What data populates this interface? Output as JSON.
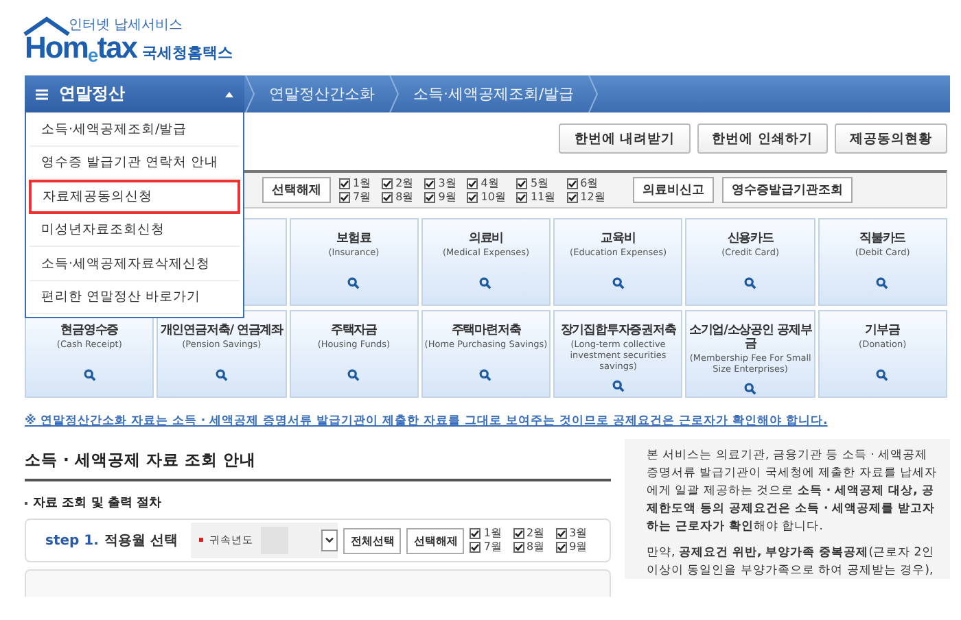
{
  "logo": {
    "tagline": "인터넷 납세서비스",
    "wordmark": "Hom$_{e}$tax",
    "name": "국세청홈택스"
  },
  "nav": {
    "menu_title": "연말정산",
    "menu_expanded": true,
    "breadcrumbs": [
      "연말정산간소화",
      "소득·세액공제조회/발급"
    ]
  },
  "menu_items": [
    {
      "label": "소득·세액공제조회/발급",
      "selected": false
    },
    {
      "label": "영수증 발급기관 연락처 안내",
      "selected": false
    },
    {
      "label": "자료제공동의신청",
      "selected": true
    },
    {
      "label": "미성년자료조회신청",
      "selected": false
    },
    {
      "label": "소득·세액공제자료삭제신청",
      "selected": false
    },
    {
      "label": "편리한 연말정산 바로가기",
      "selected": false
    }
  ],
  "actions": [
    "한번에 내려받기",
    "한번에 인쇄하기",
    "제공동의현황"
  ],
  "filter": {
    "clear_button": "선택해제",
    "months": [
      {
        "label": "1월",
        "checked": true
      },
      {
        "label": "2월",
        "checked": true
      },
      {
        "label": "3월",
        "checked": true
      },
      {
        "label": "4월",
        "checked": true
      },
      {
        "label": "5월",
        "checked": true
      },
      {
        "label": "6월",
        "checked": true
      },
      {
        "label": "7월",
        "checked": true
      },
      {
        "label": "8월",
        "checked": true
      },
      {
        "label": "9월",
        "checked": true
      },
      {
        "label": "10월",
        "checked": true
      },
      {
        "label": "11월",
        "checked": true
      },
      {
        "label": "12월",
        "checked": true
      }
    ],
    "buttons": [
      "의료비신고",
      "영수증발급기관조회"
    ]
  },
  "tiles_row_1": [
    {
      "title": "보험료",
      "subtitle": "(Insurance)"
    },
    {
      "title": "의료비",
      "subtitle": "(Medical Expenses)"
    },
    {
      "title": "교육비",
      "subtitle": "(Education Expenses)"
    },
    {
      "title": "신용카드",
      "subtitle": "(Credit Card)"
    },
    {
      "title": "직불카드",
      "subtitle": "(Debit Card)"
    }
  ],
  "tiles_row_2": [
    {
      "title": "현금영수증",
      "subtitle": "(Cash Receipt)"
    },
    {
      "title": "개인연금저축/ 연금계좌",
      "subtitle": "(Pension Savings)"
    },
    {
      "title": "주택자금",
      "subtitle": "(Housing Funds)"
    },
    {
      "title": "주택마련저축",
      "subtitle": "(Home Purchasing Savings)"
    },
    {
      "title": "장기집합투자증권저축",
      "subtitle": "(Long-term collective investment securities savings)"
    },
    {
      "title": "소기업/소상공인 공제부금",
      "subtitle": "(Membership Fee For Small Size Enterprises)"
    },
    {
      "title": "기부금",
      "subtitle": "(Donation)"
    }
  ],
  "notice": "※ 연말정산간소화 자료는 소득 · 세액공제 증명서류 발급기관이 제출한 자료를 그대로 보여주는 것이므로 공제요건은 근로자가 확인해야 합니다.",
  "guide": {
    "heading": "소득 · 세액공제 자료 조회 안내",
    "subheading": "자료 조회 및 출력 절차",
    "step": {
      "number": "step 1.",
      "title": "적용월 선택",
      "year_label": "귀속년도",
      "buttons": [
        "전체선택",
        "선택해제"
      ],
      "months": [
        {
          "label": "1월",
          "checked": true
        },
        {
          "label": "2월",
          "checked": true
        },
        {
          "label": "3월",
          "checked": true
        },
        {
          "label": "7월",
          "checked": true
        },
        {
          "label": "8월",
          "checked": true
        },
        {
          "label": "9월",
          "checked": true
        }
      ]
    }
  },
  "info": [
    "본 서비스는 의료기관, 금융기관 등 소득 · 세액공제 증명서류 발급기관이 국세청에 제출한 자료를 납세자에게 일괄 제공하는 것으로 **소득 · 세액공제 대상, 공제한도액 등의 공제요건은 소득 · 세액공제를 받고자 하는 근로자가 확인**해야 합니다.",
    "만약, **공제요건 위반, 부양가족 중복공제**(근로자 2인 이상이 동일인을 부양가족으로 하여 공제받는 경우),"
  ]
}
